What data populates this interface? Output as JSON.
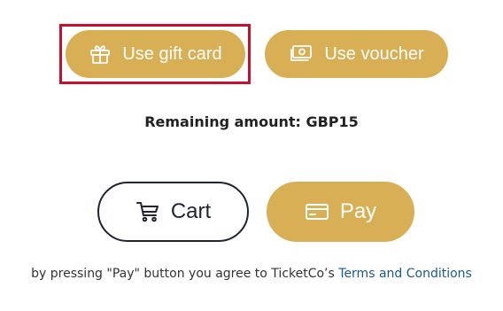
{
  "payment_options": {
    "gift_card_label": "Use gift card",
    "voucher_label": "Use voucher",
    "gift_icon": "gift-icon",
    "voucher_icon": "voucher-icon"
  },
  "remaining": {
    "text": "Remaining amount: GBP15"
  },
  "actions": {
    "cart_label": "Cart",
    "pay_label": "Pay",
    "cart_icon": "cart-icon",
    "pay_icon": "credit-card-icon"
  },
  "terms": {
    "prefix": "by pressing \"Pay\" button you agree to TicketCo’s",
    "link_text": "Terms and Conditions"
  },
  "colors": {
    "accent": "#d8af54",
    "highlight": "#c8102e",
    "outline": "#1f2433",
    "link": "#1a5a8a"
  }
}
